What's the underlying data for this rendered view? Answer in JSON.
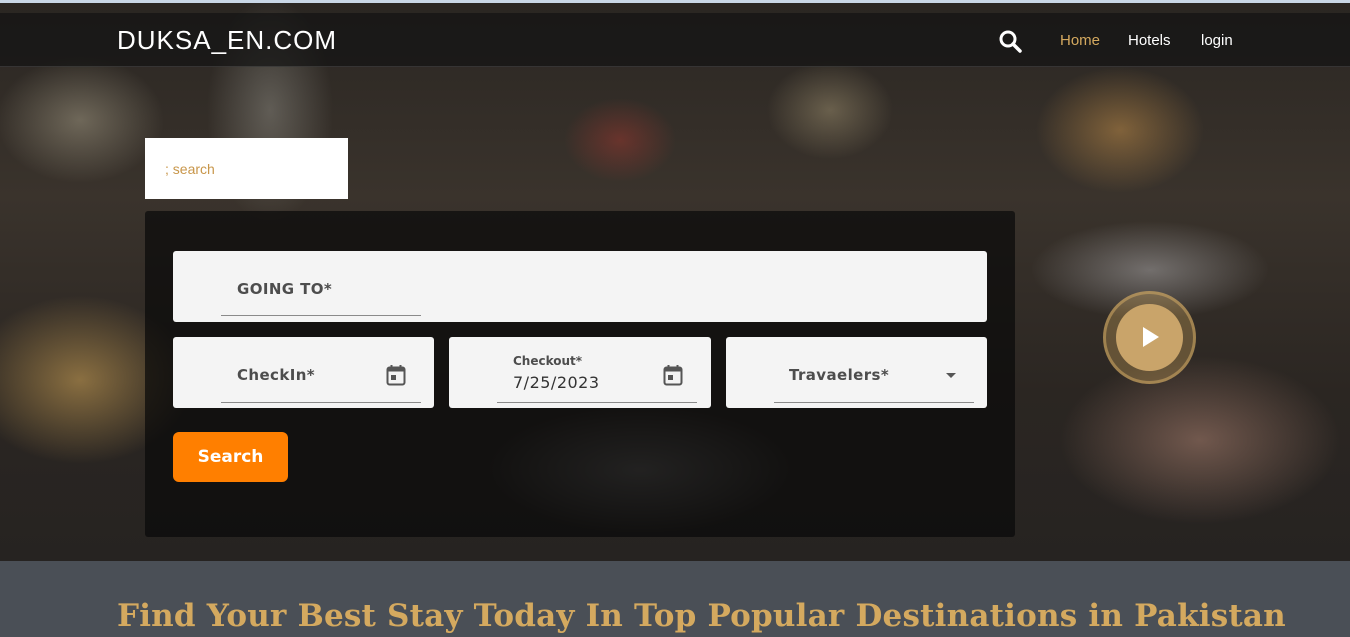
{
  "navbar": {
    "brand": "DUKSA_EN.COM",
    "links": [
      {
        "label": "Home",
        "active": true
      },
      {
        "label": "Hotels",
        "active": false
      },
      {
        "label": "login",
        "active": false
      }
    ],
    "search_icon": "search-icon"
  },
  "mini_search": {
    "placeholder": "; search"
  },
  "booking_form": {
    "going_to_label": "GOING TO*",
    "checkin_label": "CheckIn*",
    "checkout_label": "Checkout*",
    "checkout_value": "7/25/2023",
    "travelers_label": "Travaelers*",
    "search_button": "Search",
    "calendar_icon": "calendar-icon",
    "dropdown_icon": "dropdown-arrow-icon"
  },
  "video": {
    "play_icon": "play-icon"
  },
  "headline": "Find Your Best Stay Today In Top Popular Destinations in Pakistan",
  "colors": {
    "accent_gold": "#d4a95f",
    "search_button": "#ff7f00",
    "bottom_band": "#4a4f56"
  }
}
